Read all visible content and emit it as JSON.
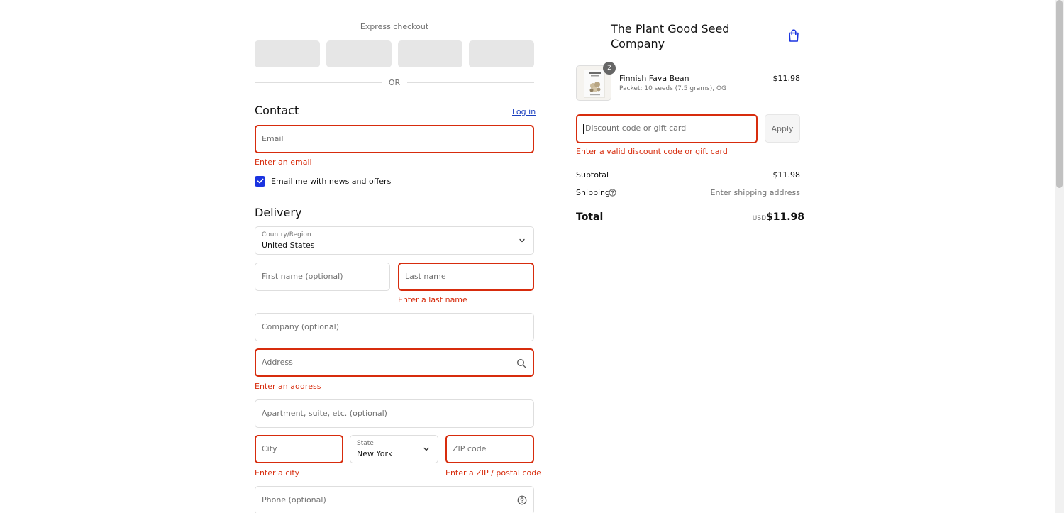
{
  "express": {
    "title": "Express checkout",
    "or": "OR"
  },
  "contact": {
    "title": "Contact",
    "login": "Log in",
    "email_placeholder": "Email",
    "email_error": "Enter an email",
    "newsletter_label": "Email me with news and offers",
    "newsletter_checked": true
  },
  "delivery": {
    "title": "Delivery",
    "country_label": "Country/Region",
    "country_value": "United States",
    "first_name_placeholder": "First name (optional)",
    "last_name_placeholder": "Last name",
    "last_name_error": "Enter a last name",
    "company_placeholder": "Company (optional)",
    "address_placeholder": "Address",
    "address_error": "Enter an address",
    "apartment_placeholder": "Apartment, suite, etc. (optional)",
    "city_placeholder": "City",
    "city_error": "Enter a city",
    "state_label": "State",
    "state_value": "New York",
    "zip_placeholder": "ZIP code",
    "zip_error": "Enter a ZIP / postal code",
    "phone_placeholder": "Phone (optional)"
  },
  "store": {
    "name": "The Plant Good Seed Company"
  },
  "cart": {
    "item": {
      "quantity": "2",
      "name": "Finnish Fava Bean",
      "variant": "Packet: 10 seeds (7.5 grams), OG",
      "price": "$11.98"
    },
    "discount_placeholder": "Discount code or gift card",
    "apply_label": "Apply",
    "discount_error": "Enter a valid discount code or gift card"
  },
  "summary": {
    "subtotal_label": "Subtotal",
    "subtotal_value": "$11.98",
    "shipping_label": "Shipping",
    "shipping_value": "Enter shipping address",
    "total_label": "Total",
    "total_currency": "USD",
    "total_value": "$11.98"
  },
  "colors": {
    "error": "#d72c0d",
    "accent": "#1a33e0",
    "link": "#1a3fbf"
  }
}
